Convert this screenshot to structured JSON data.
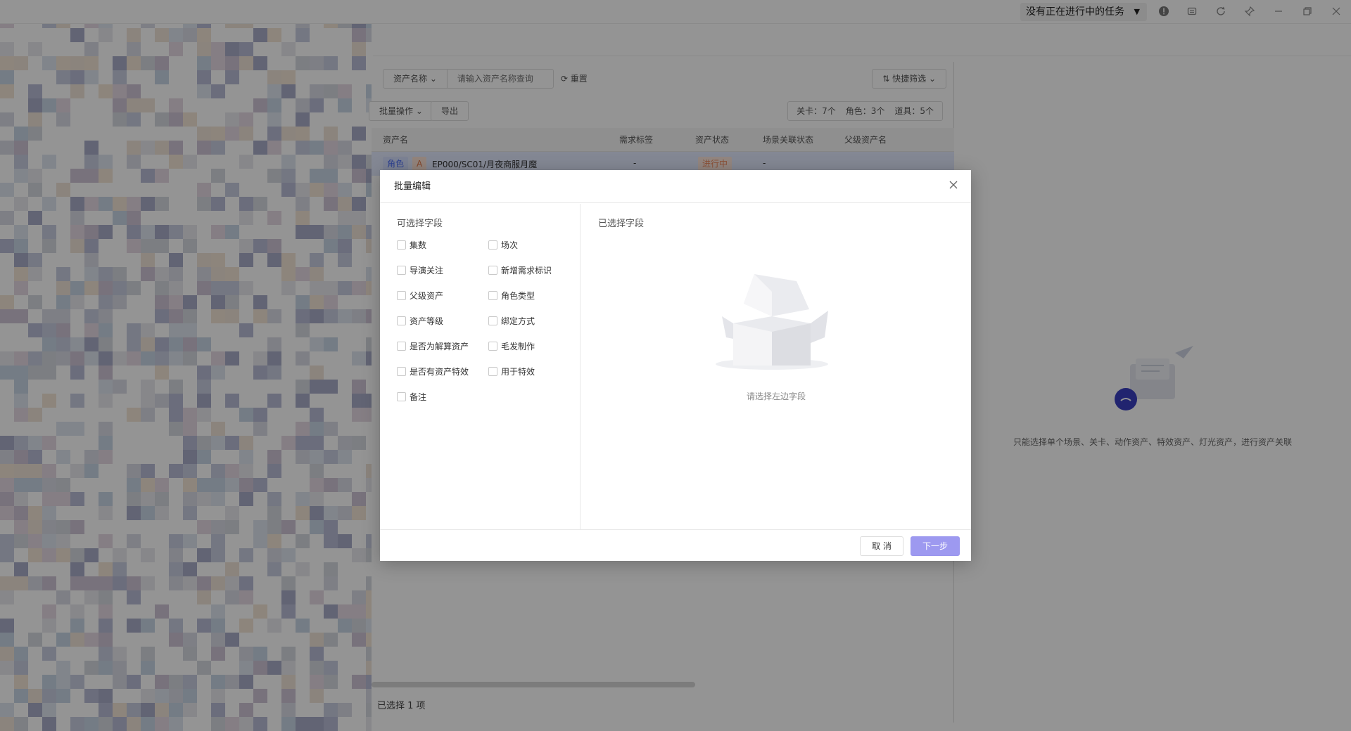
{
  "titlebar": {
    "task_status": "没有正在进行中的任务"
  },
  "icons": {
    "caret": "▼",
    "info": "info-icon",
    "dropdown_chevron": "⌄"
  },
  "filters": {
    "field_select": "资产名称",
    "search_placeholder": "请输入资产名称查询",
    "reset": "重置",
    "quick_filter": "快捷筛选"
  },
  "toolbar": {
    "batch_ops": "批量操作",
    "export": "导出",
    "stats": {
      "levels": "关卡：7个",
      "roles": "角色：3个",
      "props": "道具：5个"
    }
  },
  "table": {
    "columns": [
      "资产名",
      "需求标签",
      "资产状态",
      "场景关联状态",
      "父级资产名"
    ],
    "rows": [
      {
        "type": "角色",
        "grade": "A",
        "name": "EP000/SC01/月夜商服月魔",
        "req_tag": "-",
        "status": "进行中",
        "scene_status": "-"
      }
    ]
  },
  "footer": {
    "selected": "已选择 1 项"
  },
  "right_empty": {
    "message": "只能选择单个场景、关卡、动作资产、特效资产、灯光资产，进行资产关联"
  },
  "modal": {
    "title": "批量编辑",
    "left_title": "可选择字段",
    "right_title": "已选择字段",
    "fields": [
      "集数",
      "场次",
      "导演关注",
      "新增需求标识",
      "父级资产",
      "角色类型",
      "资产等级",
      "绑定方式",
      "是否为解算资产",
      "毛发制作",
      "是否有资产特效",
      "用于特效",
      "备注"
    ],
    "empty_hint": "请选择左边字段",
    "cancel": "取 消",
    "next": "下一步"
  },
  "colors": {
    "accent": "#9d99f0",
    "selected_row": "#e4ebff",
    "status_in_progress": "#f08a5d",
    "role_tag": "#4a6cf7"
  }
}
